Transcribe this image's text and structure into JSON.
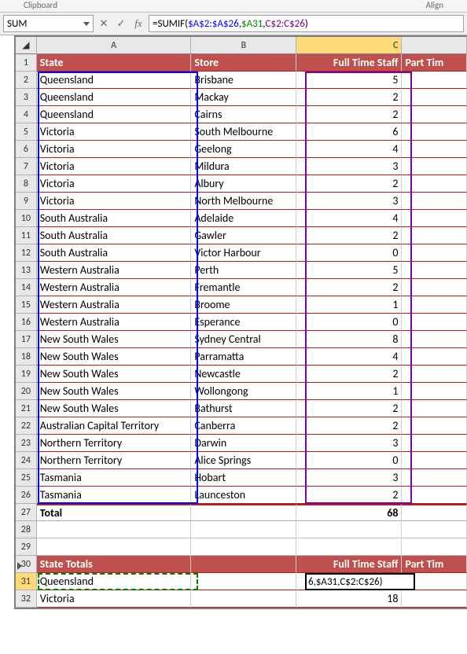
{
  "ribbon": {
    "left": "Clipboard",
    "right": "Align"
  },
  "name_box": "SUM",
  "formula_parts": {
    "prefix": "=SUMIF(",
    "ref1": "$A$2:$A$26",
    "sep1": ",",
    "ref2": "$A31",
    "sep2": ",",
    "ref3": "C$2:C$26",
    "suffix": ")"
  },
  "columns": [
    "A",
    "B",
    "C"
  ],
  "headers": {
    "A": "State",
    "B": "Store",
    "C": "Full Time Staff",
    "D": "Part Tim"
  },
  "rows": [
    {
      "n": 2,
      "A": "Queensland",
      "B": "Brisbane",
      "C": "5"
    },
    {
      "n": 3,
      "A": "Queensland",
      "B": "Mackay",
      "C": "2"
    },
    {
      "n": 4,
      "A": "Queensland",
      "B": "Cairns",
      "C": "2"
    },
    {
      "n": 5,
      "A": "Victoria",
      "B": "South Melbourne",
      "C": "6"
    },
    {
      "n": 6,
      "A": "Victoria",
      "B": "Geelong",
      "C": "4"
    },
    {
      "n": 7,
      "A": "Victoria",
      "B": "Mildura",
      "C": "3"
    },
    {
      "n": 8,
      "A": "Victoria",
      "B": "Albury",
      "C": "2"
    },
    {
      "n": 9,
      "A": "Victoria",
      "B": "North Melbourne",
      "C": "3"
    },
    {
      "n": 10,
      "A": "South Australia",
      "B": "Adelaide",
      "C": "4"
    },
    {
      "n": 11,
      "A": "South Australia",
      "B": "Gawler",
      "C": "2"
    },
    {
      "n": 12,
      "A": "South Australia",
      "B": "Victor Harbour",
      "C": "0"
    },
    {
      "n": 13,
      "A": "Western Australia",
      "B": "Perth",
      "C": "5"
    },
    {
      "n": 14,
      "A": "Western Australia",
      "B": "Fremantle",
      "C": "2"
    },
    {
      "n": 15,
      "A": "Western Australia",
      "B": "Broome",
      "C": "1"
    },
    {
      "n": 16,
      "A": "Western Australia",
      "B": "Esperance",
      "C": "0"
    },
    {
      "n": 17,
      "A": "New South Wales",
      "B": "Sydney Central",
      "C": "8"
    },
    {
      "n": 18,
      "A": "New South Wales",
      "B": "Parramatta",
      "C": "4"
    },
    {
      "n": 19,
      "A": "New South Wales",
      "B": "Newcastle",
      "C": "2"
    },
    {
      "n": 20,
      "A": "New South Wales",
      "B": "Wollongong",
      "C": "1"
    },
    {
      "n": 21,
      "A": "New South Wales",
      "B": "Bathurst",
      "C": "2"
    },
    {
      "n": 22,
      "A": "Australian Capital Territory",
      "B": "Canberra",
      "C": "2"
    },
    {
      "n": 23,
      "A": "Northern Territory",
      "B": "Darwin",
      "C": "3"
    },
    {
      "n": 24,
      "A": "Northern Territory",
      "B": "Alice Springs",
      "C": "0"
    },
    {
      "n": 25,
      "A": "Tasmania",
      "B": "Hobart",
      "C": "3"
    },
    {
      "n": 26,
      "A": "Tasmania",
      "B": "Launceston",
      "C": "2"
    }
  ],
  "total": {
    "n": 27,
    "label": "Total",
    "value": "68"
  },
  "headers2": {
    "n": 30,
    "A": "State Totals",
    "C": "Full Time Staff",
    "D": "Part Tim"
  },
  "totals": [
    {
      "n": 31,
      "A": "Queensland",
      "display": "6,$A31,C$2:C$26)"
    },
    {
      "n": 32,
      "A": "Victoria",
      "C": "18"
    }
  ]
}
